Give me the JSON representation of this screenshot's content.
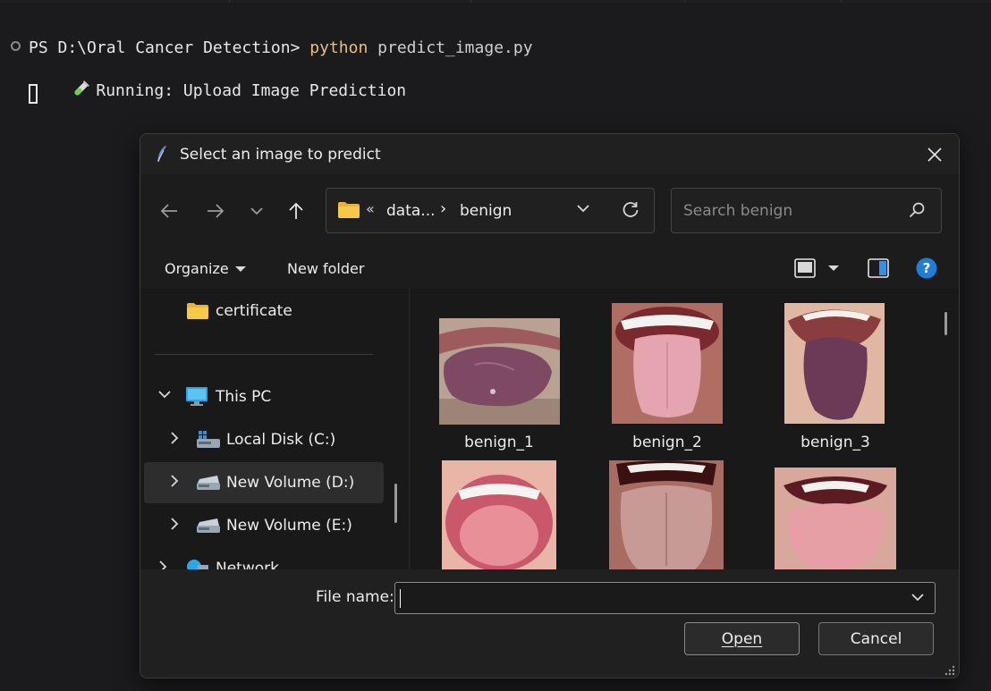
{
  "terminal": {
    "prompt": "PS D:\\Oral Cancer Detection> ",
    "command": "python",
    "argument": " predict_image.py",
    "status_icon": "test-tube-icon",
    "status_text": "Running: Upload Image Prediction"
  },
  "dialog": {
    "title": "Select an image to predict",
    "address": {
      "segment1": "data...",
      "segment2": "benign"
    },
    "search_placeholder": "Search benign",
    "commands": {
      "organize": "Organize",
      "new_folder": "New folder"
    },
    "nav_tree": [
      {
        "label": "certificate",
        "icon": "folder-icon"
      },
      {
        "label": "This PC",
        "icon": "monitor-icon"
      },
      {
        "label": "Local Disk (C:)",
        "icon": "drive-icon"
      },
      {
        "label": "New Volume (D:)",
        "icon": "drive-icon",
        "selected": true
      },
      {
        "label": "New Volume (E:)",
        "icon": "drive-icon"
      },
      {
        "label": "Network",
        "icon": "network-icon"
      }
    ],
    "files": [
      {
        "name": "benign_1"
      },
      {
        "name": "benign_2"
      },
      {
        "name": "benign_3"
      },
      {
        "name": ""
      },
      {
        "name": ""
      },
      {
        "name": ""
      }
    ],
    "file_name_label": "File name:",
    "file_name_value": "",
    "open_label": "Open",
    "cancel_label": "Cancel"
  }
}
